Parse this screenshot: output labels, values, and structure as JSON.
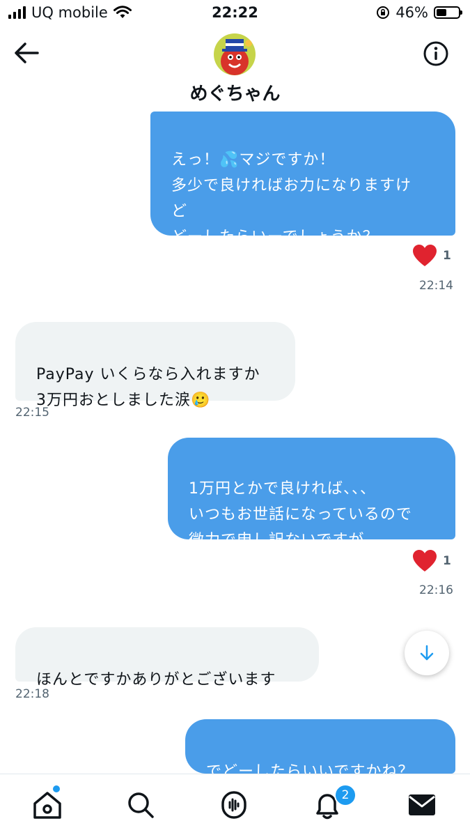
{
  "status_bar": {
    "carrier": "UQ mobile",
    "time": "22:22",
    "battery": "46%",
    "battery_level": 0.46
  },
  "header": {
    "contact_name": "めぐちゃん"
  },
  "messages": [
    {
      "side": "sent",
      "text": "えっ！💦マジですか！\n多少で良ければお力になりますけ\nど\nどーしたらいーでしょうか？",
      "reaction": "❤️",
      "reaction_count": "1",
      "time": "22:14"
    },
    {
      "side": "received",
      "text": "PayPay いくらなら入れますか\n3万円おとしました涙🥲",
      "time": "22:15"
    },
    {
      "side": "sent",
      "text": "1万円とかで良ければ、、、\nいつもお世話になっているので\n微力で申し訳ないですが、、、",
      "reaction": "❤️",
      "reaction_count": "1",
      "time": "22:16"
    },
    {
      "side": "received",
      "text": "ほんとですかありがとございます",
      "time": "22:18"
    },
    {
      "side": "sent",
      "text": "でどーしたらいいですかね？"
    }
  ],
  "tab_bar": {
    "items": [
      "home-icon",
      "search-icon",
      "spaces-icon",
      "notifications-icon",
      "messages-icon"
    ],
    "notifications_badge": "2"
  },
  "colors": {
    "sent_bubble": "#4a9de9",
    "received_bubble": "#eff3f4",
    "accent": "#1d9bf0"
  }
}
